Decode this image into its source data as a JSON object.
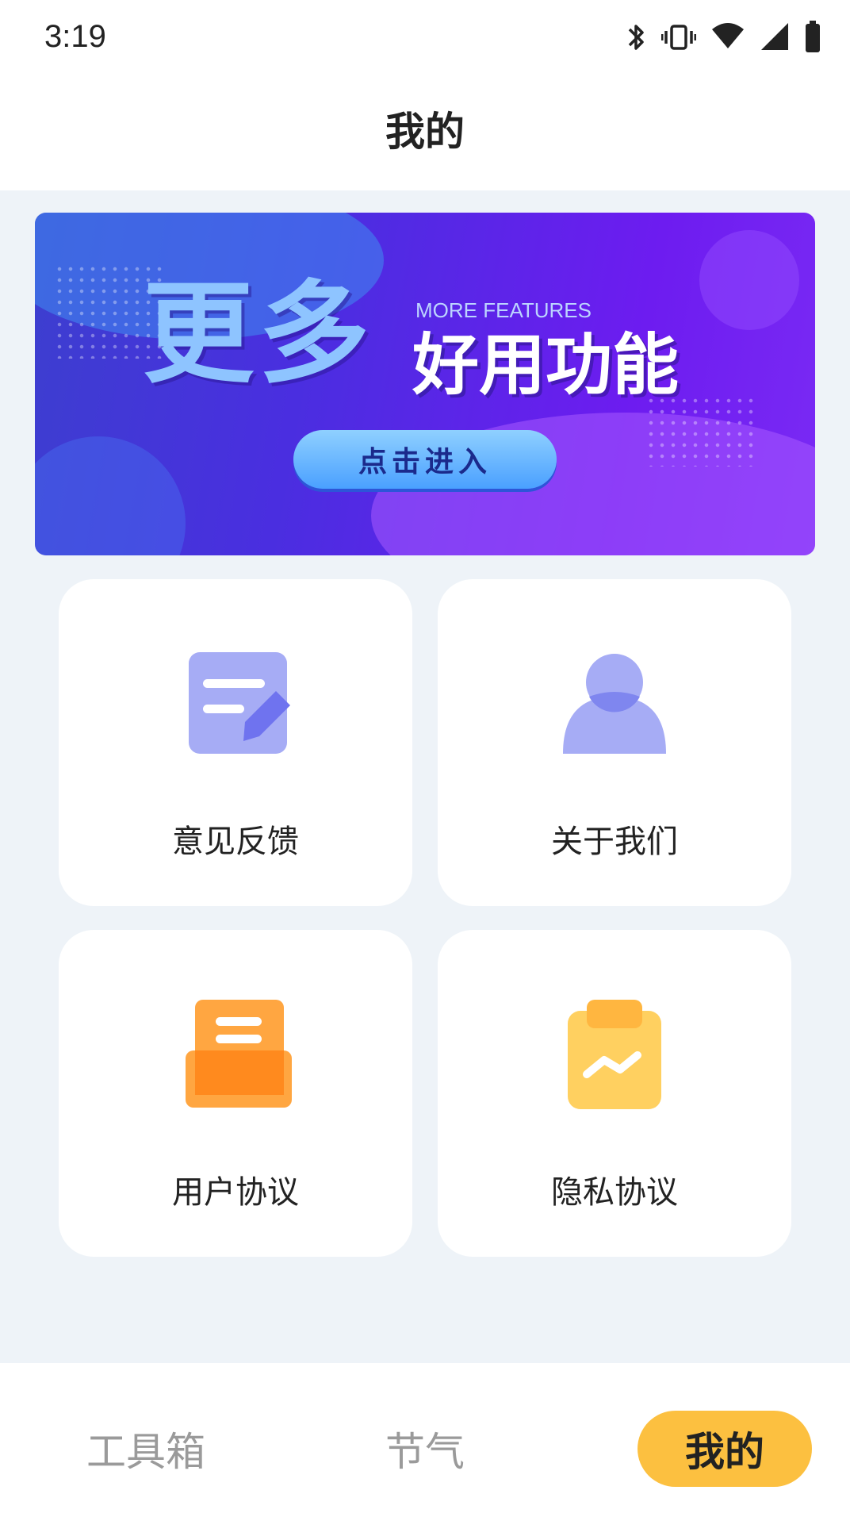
{
  "status_bar": {
    "time": "3:19",
    "icons": [
      "bluetooth-icon",
      "vibrate-icon",
      "wifi-icon",
      "signal-icon",
      "battery-icon"
    ]
  },
  "app_bar": {
    "title": "我的"
  },
  "banner": {
    "headline": "更多",
    "english": "MORE FEATURES",
    "subhead": "好用功能",
    "button_label": "点击进入",
    "colors": {
      "start": "#3c3fcf",
      "end": "#7a2af4",
      "button": "#4aa0ff"
    }
  },
  "cards": [
    {
      "label": "意见反馈",
      "icon": "edit-note-icon"
    },
    {
      "label": "关于我们",
      "icon": "user-icon"
    },
    {
      "label": "用户协议",
      "icon": "inbox-document-icon"
    },
    {
      "label": "隐私协议",
      "icon": "clipboard-chart-icon"
    }
  ],
  "bottom_nav": {
    "items": [
      {
        "label": "工具箱",
        "active": false
      },
      {
        "label": "节气",
        "active": false
      },
      {
        "label": "我的",
        "active": true
      }
    ],
    "active_color": "#fcc040"
  }
}
